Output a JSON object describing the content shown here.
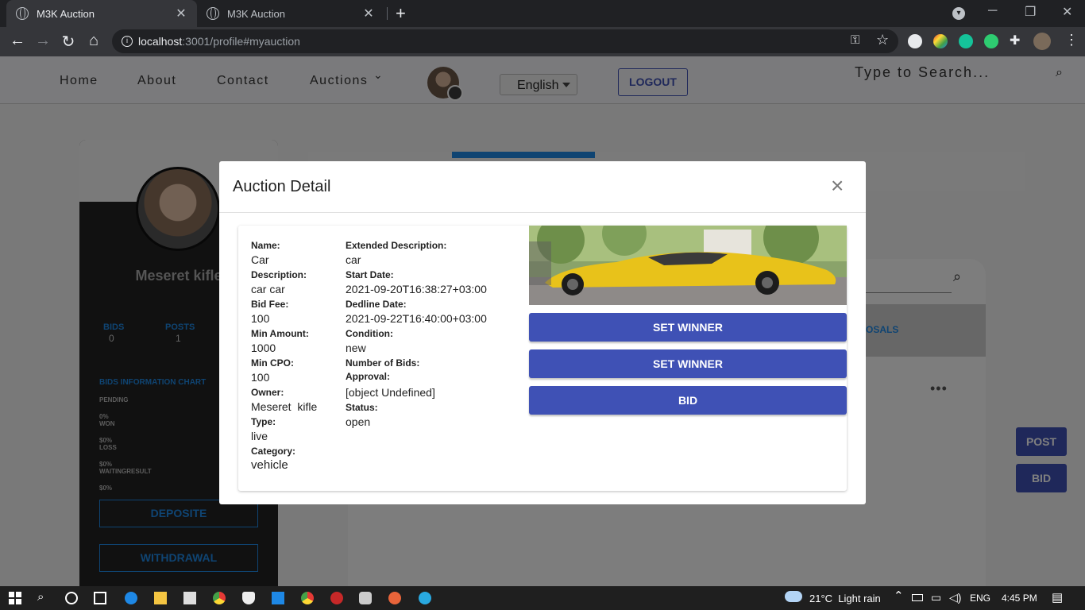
{
  "browser": {
    "tabs": [
      {
        "title": "M3K Auction",
        "active": true
      },
      {
        "title": "M3K Auction",
        "active": false
      }
    ],
    "new_tab": "+",
    "url_host": "localhost",
    "url_rest": ":3001/profile#myauction"
  },
  "site_nav": {
    "links": [
      "Home",
      "About",
      "Contact",
      "Auctions"
    ],
    "language": "English",
    "logout": "LOGOUT",
    "search_placeholder": "Type to Search..."
  },
  "profile": {
    "name": "Meseret kifle",
    "bids_label": "BIDS",
    "bids_value": "0",
    "posts_label": "POSTS",
    "posts_value": "1",
    "chart_title": "BIDS INFORMATION CHART",
    "chart_rows": [
      "PENDING",
      "0%",
      "WON",
      "$0%",
      "LOSS",
      "$0%",
      "WAITINGRESULT",
      "$0%"
    ],
    "deposit": "DEPOSITE",
    "withdrawal": "WITHDRAWAL"
  },
  "background": {
    "tab_fragment": "OSALS",
    "more": "•••",
    "post_button": "POST",
    "bid_button": "BID"
  },
  "modal": {
    "title": "Auction Detail",
    "close": "×",
    "left_fields": [
      {
        "label": "Name:",
        "value": "Car"
      },
      {
        "label": "Description:",
        "value": "car car"
      },
      {
        "label": "Bid Fee:",
        "value": "100"
      },
      {
        "label": "Min Amount:",
        "value": "1000"
      },
      {
        "label": "Min CPO:",
        "value": "100"
      },
      {
        "label": "Owner:",
        "value": "Meseret  kifle"
      },
      {
        "label": "Type:",
        "value": "live"
      },
      {
        "label": "Category:",
        "value": "vehicle"
      }
    ],
    "right_fields": [
      {
        "label": "Extended Description:",
        "value": "car"
      },
      {
        "label": "Start Date:",
        "value": "2021-09-20T16:38:27+03:00"
      },
      {
        "label": "Dedline Date:",
        "value": "2021-09-22T16:40:00+03:00"
      },
      {
        "label": "Condition:",
        "value": "new"
      },
      {
        "label": "Number of Bids:",
        "value": ""
      },
      {
        "label": "Approval:",
        "value": "[object Undefined]"
      },
      {
        "label": "Status:",
        "value": "open"
      }
    ],
    "buttons": [
      "SET WINNER",
      "SET WINNER",
      "BID"
    ]
  },
  "taskbar": {
    "weather": "21°C  Light rain",
    "language": "ENG",
    "time": "4:45 PM"
  },
  "colors": {
    "primary": "#3f51b5",
    "accent": "#1e88e5",
    "car_yellow": "#e8c21a"
  }
}
